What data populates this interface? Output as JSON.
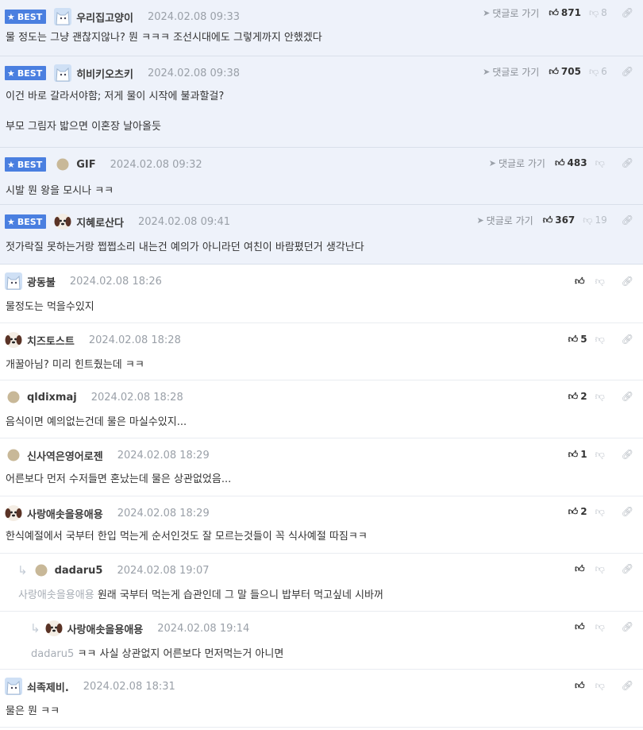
{
  "labels": {
    "best": "BEST",
    "jump": "댓글로 가기"
  },
  "icons": {
    "like": "thumbs-up-icon",
    "dislike": "thumbs-down-icon",
    "link": "link-icon",
    "jump": "send-icon",
    "reply": "reply-arrow-icon",
    "best": "star-icon"
  },
  "colors": {
    "best_badge": "#4a7fe0",
    "best_background": "#eef2fa",
    "date": "#9aa0a8",
    "mention": "#a7adb5"
  },
  "comments": [
    {
      "best": true,
      "avatar": "white-cat-avatar",
      "nick": "우리집고양이",
      "date": "2024.02.08 09:33",
      "likes": "871",
      "dislikes": "8",
      "lines": [
        "물 정도는 그냥 괜찮지않나? 뭔 ㅋㅋㅋ 조선시대에도 그렇게까지 안했겠다"
      ]
    },
    {
      "best": true,
      "avatar": "white-cat-avatar",
      "nick": "히비키오츠키",
      "date": "2024.02.08 09:38",
      "likes": "705",
      "dislikes": "6",
      "lines": [
        "이건 바로 갈라서야함; 저게 물이 시작에 불과할걸?",
        "",
        "부모 그림자 밟으면 이혼장 날아올듯"
      ]
    },
    {
      "best": true,
      "avatar": "default-avatar",
      "nick": "GIF",
      "date": "2024.02.08 09:32",
      "likes": "483",
      "dislikes": "",
      "lines": [
        "시발 뭔 왕을 모시나 ㅋㅋ"
      ]
    },
    {
      "best": true,
      "avatar": "puppy-avatar",
      "nick": "지혜로산다",
      "date": "2024.02.08 09:41",
      "likes": "367",
      "dislikes": "19",
      "lines": [
        "젓가락질 못하는거랑 쩝쩝소리 내는건 예의가 아니라던 여친이 바람폈던거 생각난다"
      ]
    },
    {
      "best": false,
      "avatar": "white-cat-avatar",
      "nick": "광동불",
      "date": "2024.02.08 18:26",
      "likes": "",
      "dislikes": "",
      "lines": [
        "물정도는 먹을수있지"
      ]
    },
    {
      "best": false,
      "avatar": "puppy-avatar",
      "nick": "치즈토스트",
      "date": "2024.02.08 18:28",
      "likes": "5",
      "dislikes": "",
      "lines": [
        "개꿀아님? 미리 힌트줬는데 ㅋㅋ"
      ]
    },
    {
      "best": false,
      "avatar": "default-avatar",
      "nick": "qldixmaj",
      "date": "2024.02.08 18:28",
      "likes": "2",
      "dislikes": "",
      "lines": [
        "음식이면 예의없는건데 물은 마실수있지..."
      ]
    },
    {
      "best": false,
      "avatar": "default-avatar",
      "nick": "신사역은영어로젠",
      "date": "2024.02.08 18:29",
      "likes": "1",
      "dislikes": "",
      "lines": [
        "어른보다 먼저 수저들면 혼났는데 물은 상관없었음..."
      ]
    },
    {
      "best": false,
      "avatar": "puppy-avatar",
      "nick": "사랑애솟을용애용",
      "date": "2024.02.08 18:29",
      "likes": "2",
      "dislikes": "",
      "lines": [
        "한식예절에서 국부터 한입 먹는게 순서인것도 잘 모르는것들이 꼭 식사예절 따짐ㅋㅋ"
      ]
    },
    {
      "best": false,
      "reply": 1,
      "avatar": "default-avatar",
      "nick": "dadaru5",
      "date": "2024.02.08 19:07",
      "likes": "",
      "dislikes": "",
      "mention": "사랑애솟을용애용",
      "lines": [
        "원래 국부터 먹는게 습관인데 그 말 들으니 밥부터 먹고싶네 시바꺼"
      ]
    },
    {
      "best": false,
      "reply": 2,
      "avatar": "puppy-avatar",
      "nick": "사랑애솟을용애용",
      "date": "2024.02.08 19:14",
      "likes": "",
      "dislikes": "",
      "mention": "dadaru5",
      "lines": [
        "ㅋㅋ 사실 상관없지 어른보다 먼저먹는거 아니면"
      ]
    },
    {
      "best": false,
      "avatar": "white-cat-avatar",
      "nick": "쇠족제비.",
      "date": "2024.02.08 18:31",
      "likes": "",
      "dislikes": "",
      "lines": [
        "물은 뭔 ㅋㅋ"
      ]
    }
  ]
}
